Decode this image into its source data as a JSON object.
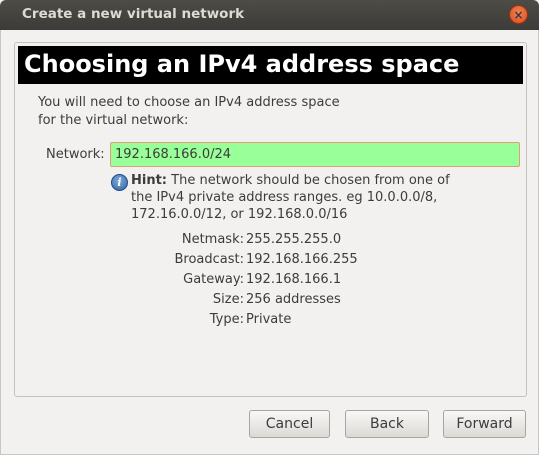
{
  "window": {
    "title": "Create a new virtual network",
    "close_glyph": "×"
  },
  "page": {
    "heading": "Choosing an IPv4 address space",
    "intro": "You will need to choose an IPv4 address space for the virtual network:"
  },
  "network": {
    "label": "Network:",
    "value": "192.168.166.0/24",
    "valid_color": "#99ff99"
  },
  "hint": {
    "icon": "info-icon",
    "bold": "Hint:",
    "text": " The network should be chosen from one of the IPv4 private address ranges. eg 10.0.0.0/8,  172.16.0.0/12, or 192.168.0.0/16"
  },
  "details": [
    {
      "label": "Netmask:",
      "value": "255.255.255.0"
    },
    {
      "label": "Broadcast:",
      "value": "192.168.166.255"
    },
    {
      "label": "Gateway:",
      "value": "192.168.166.1"
    },
    {
      "label": "Size:",
      "value": "256 addresses"
    },
    {
      "label": "Type:",
      "value": "Private"
    }
  ],
  "buttons": {
    "cancel": "Cancel",
    "back": "Back",
    "forward": "Forward"
  }
}
